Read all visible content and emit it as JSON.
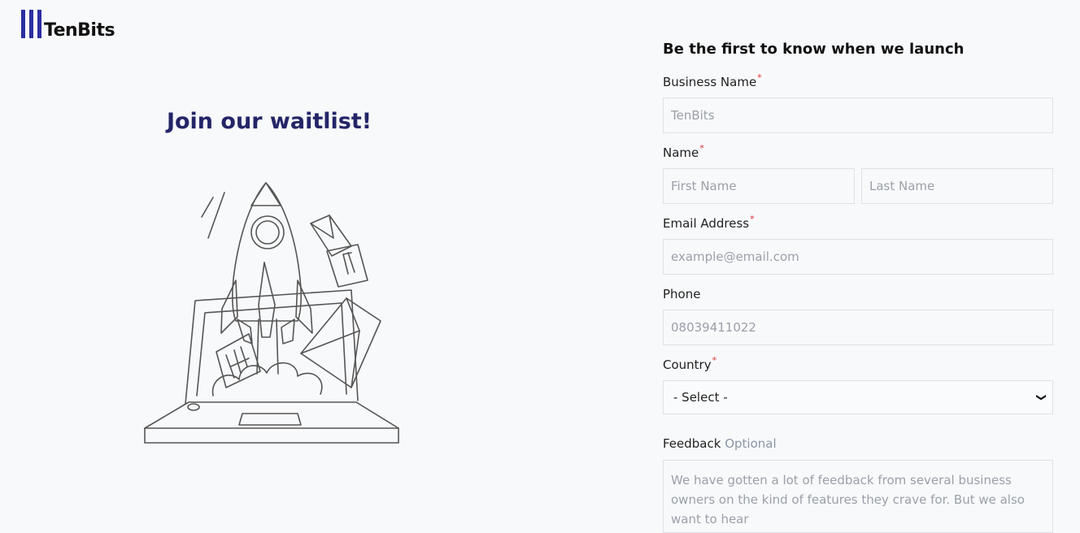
{
  "brand": {
    "name": "TenBits",
    "color": "#2b2fa0"
  },
  "hero": {
    "title": "Join our waitlist!",
    "illustration": "rocket-launching-from-laptop"
  },
  "form": {
    "title": "Be the first to know when we launch",
    "business_name": {
      "label": "Business Name",
      "required_mark": "*",
      "placeholder": "TenBits"
    },
    "name": {
      "label": "Name",
      "required_mark": "*",
      "first_placeholder": "First Name",
      "last_placeholder": "Last Name"
    },
    "email": {
      "label": "Email Address",
      "required_mark": "*",
      "placeholder": "example@email.com"
    },
    "phone": {
      "label": "Phone",
      "placeholder": "08039411022"
    },
    "country": {
      "label": "Country",
      "required_mark": "*",
      "selected": "- Select -"
    },
    "feedback": {
      "label": "Feedback",
      "optional_label": "Optional",
      "placeholder": "We have gotten a lot of feedback from several business owners on the kind of features they crave for. But we also want to hear"
    }
  }
}
